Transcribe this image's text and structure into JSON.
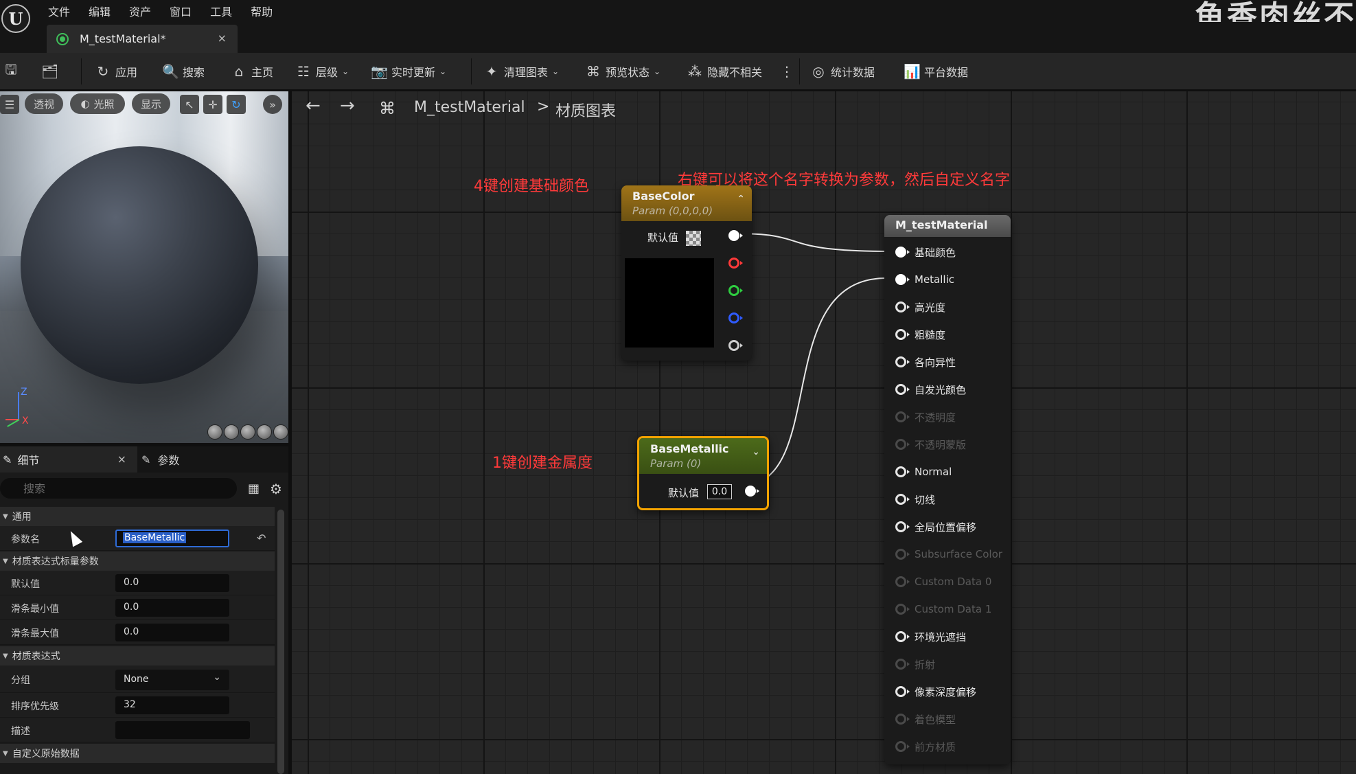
{
  "menu": {
    "logo": "U",
    "items": [
      "文件",
      "编辑",
      "资产",
      "窗口",
      "工具",
      "帮助"
    ],
    "watermark": "鱼香肉丝不"
  },
  "tab": {
    "label": "M_testMaterial*",
    "close": "×"
  },
  "toolbar": {
    "apply": "应用",
    "search": "搜索",
    "home": "主页",
    "hierarchy": "层级",
    "live_update": "实时更新",
    "clean_graph": "清理图表",
    "preview_state": "预览状态",
    "hide_unrelated": "隐藏不相关",
    "stats": "统计数据",
    "platform_stats": "平台数据"
  },
  "viewport": {
    "perspective": "透视",
    "lighting": "光照",
    "show": "显示",
    "axis_z": "Z",
    "axis_x": "X"
  },
  "details": {
    "tab_details": "细节",
    "tab_params": "参数",
    "search_placeholder": "搜索",
    "sections": {
      "general": "通用",
      "scalar_params": "材质表达式标量参数",
      "expression": "材质表达式",
      "custom_primitive": "自定义原始数据"
    },
    "rows": {
      "param_name": {
        "label": "参数名",
        "value": "BaseMetallic"
      },
      "default": {
        "label": "默认值",
        "value": "0.0"
      },
      "slider_min": {
        "label": "滑条最小值",
        "value": "0.0"
      },
      "slider_max": {
        "label": "滑条最大值",
        "value": "0.0"
      },
      "group": {
        "label": "分组",
        "value": "None"
      },
      "sort_priority": {
        "label": "排序优先级",
        "value": "32"
      },
      "desc": {
        "label": "描述",
        "value": ""
      }
    }
  },
  "graph": {
    "crumb_asset": "M_testMaterial",
    "crumb_sep": ">",
    "crumb_graph": "材质图表",
    "annotations": {
      "base_color": "4键创建基础颜色",
      "convert_param": "右键可以将这个名字转换为参数，然后自定义名字",
      "metallic": "1键创建金属度"
    },
    "node_basecolor": {
      "title": "BaseColor",
      "subtitle": "Param (0,0,0,0)",
      "default_label": "默认值"
    },
    "node_metallic": {
      "title": "BaseMetallic",
      "subtitle": "Param (0)",
      "default_label": "默认值",
      "default_value": "0.0"
    },
    "node_material": {
      "title": "M_testMaterial",
      "inputs": [
        {
          "label": "基础颜色",
          "connected": true,
          "enabled": true
        },
        {
          "label": "Metallic",
          "connected": true,
          "enabled": true
        },
        {
          "label": "高光度",
          "connected": false,
          "enabled": true
        },
        {
          "label": "粗糙度",
          "connected": false,
          "enabled": true
        },
        {
          "label": "各向异性",
          "connected": false,
          "enabled": true
        },
        {
          "label": "自发光颜色",
          "connected": false,
          "enabled": true
        },
        {
          "label": "不透明度",
          "connected": false,
          "enabled": false
        },
        {
          "label": "不透明蒙版",
          "connected": false,
          "enabled": false
        },
        {
          "label": "Normal",
          "connected": false,
          "enabled": true
        },
        {
          "label": "切线",
          "connected": false,
          "enabled": true
        },
        {
          "label": "全局位置偏移",
          "connected": false,
          "enabled": true
        },
        {
          "label": "Subsurface Color",
          "connected": false,
          "enabled": false
        },
        {
          "label": "Custom Data 0",
          "connected": false,
          "enabled": false
        },
        {
          "label": "Custom Data 1",
          "connected": false,
          "enabled": false
        },
        {
          "label": "环境光遮挡",
          "connected": false,
          "enabled": true
        },
        {
          "label": "折射",
          "connected": false,
          "enabled": false
        },
        {
          "label": "像素深度偏移",
          "connected": false,
          "enabled": true
        },
        {
          "label": "着色模型",
          "connected": false,
          "enabled": false
        },
        {
          "label": "前方材质",
          "connected": false,
          "enabled": false
        }
      ]
    }
  },
  "colors": {
    "accent_select": "#2e6bd6",
    "annotation": "#ff3a3a",
    "node_selected": "#f2a200",
    "pin_r": "#ff3a3a",
    "pin_g": "#2ecc40",
    "pin_b": "#2f5bff"
  }
}
